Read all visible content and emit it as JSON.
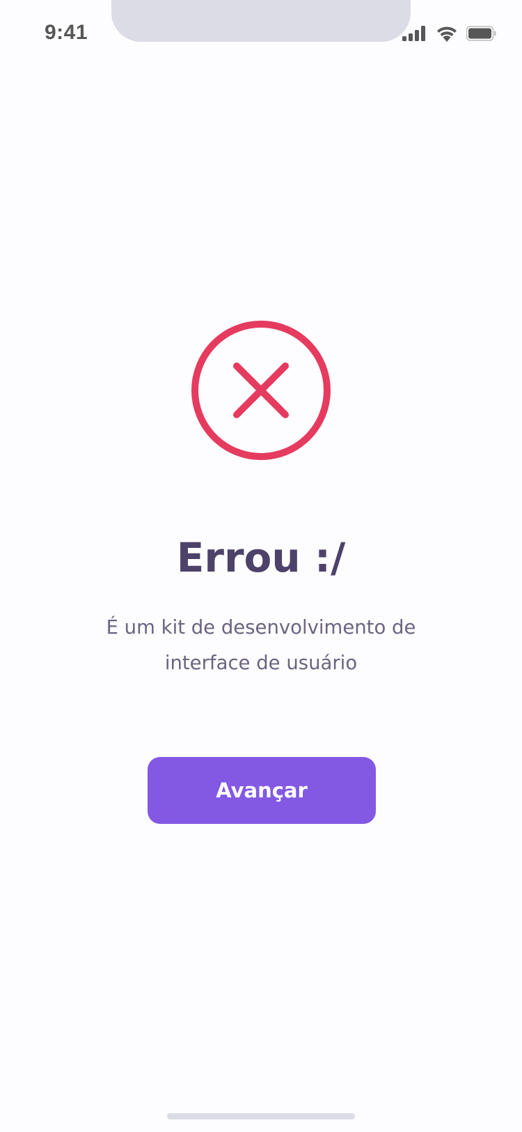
{
  "status_bar": {
    "time": "9:41",
    "signal_icon": "cellular-signal-icon",
    "wifi_icon": "wifi-icon",
    "battery_icon": "battery-icon"
  },
  "result": {
    "icon": "error-x-circle-icon",
    "icon_color": "#e53b5f",
    "title": "Errou :/",
    "description": "É um kit de desenvolvimento de interface de usuário"
  },
  "actions": {
    "next_label": "Avançar",
    "accent_color": "#8359e4"
  }
}
